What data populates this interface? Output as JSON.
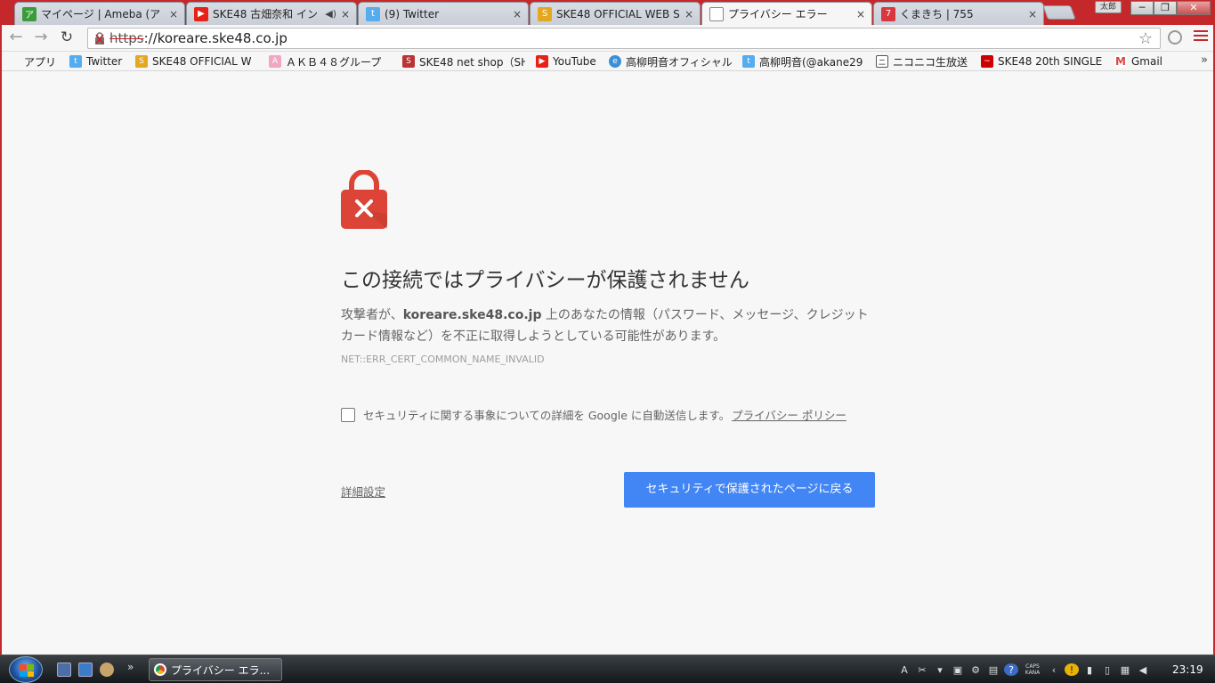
{
  "tabs": [
    {
      "title": "マイページ | Ameba (ア",
      "favicon": "ameba-icon",
      "active": false
    },
    {
      "title": "SKE48 古畑奈和 イン",
      "favicon": "youtube-icon",
      "active": false,
      "muted": true
    },
    {
      "title": "(9) Twitter",
      "favicon": "twitter-icon",
      "active": false
    },
    {
      "title": "SKE48 OFFICIAL WEB S",
      "favicon": "ske48-icon",
      "active": false
    },
    {
      "title": "プライバシー エラー",
      "favicon": "page-icon",
      "active": true
    },
    {
      "title": "くまきち | 755",
      "favicon": "755-icon",
      "active": false
    }
  ],
  "tab_close": "×",
  "mute_glyph": "◀)",
  "profile_badge": "太郎",
  "window_controls": {
    "minimize": "─",
    "restore": "❐",
    "close": "✕"
  },
  "toolbar": {
    "back": "←",
    "forward": "→",
    "reload": "↻",
    "url_scheme": "https",
    "url_rest": "://koreare.ske48.co.jp",
    "star": "☆"
  },
  "bookmarks": [
    {
      "label": "アプリ",
      "icon": "apps-icon"
    },
    {
      "label": "Twitter",
      "icon": "twitter-icon"
    },
    {
      "label": "SKE48 OFFICIAL W",
      "icon": "ske48-icon"
    },
    {
      "label": "ＡＫＢ４８グループ",
      "icon": "akb48-icon"
    },
    {
      "label": "SKE48 net shop（SH",
      "icon": "netshop-icon"
    },
    {
      "label": "YouTube",
      "icon": "youtube-icon"
    },
    {
      "label": "高柳明音オフィシャル",
      "icon": "blog-icon"
    },
    {
      "label": "高柳明音(@akane29",
      "icon": "twitter-icon"
    },
    {
      "label": "ニコニコ生放送",
      "icon": "niconico-icon"
    },
    {
      "label": "SKE48 20th SINGLE",
      "icon": "ske-single-icon"
    },
    {
      "label": "Gmail",
      "icon": "gmail-icon"
    }
  ],
  "bookmarks_more": "»",
  "interstitial": {
    "heading": "この接続ではプライバシーが保護されません",
    "explain_before": "攻撃者が、",
    "explain_host": "koreare.ske48.co.jp",
    "explain_after": " 上のあなたの情報（パスワード、メッセージ、クレジット カード情報など）を不正に取得しようとしている可能性があります。",
    "error_code": "NET::ERR_CERT_COMMON_NAME_INVALID",
    "optin_text": "セキュリティに関する事象についての詳細を Google に自動送信します。",
    "optin_link": "プライバシー ポリシー",
    "details_link": "詳細設定",
    "back_button": "セキュリティで保護されたページに戻る",
    "accent_color": "#4285f4",
    "lock_color": "#db4437"
  },
  "taskbar": {
    "item_label": "プライバシー エラ...",
    "quicklaunch_more": "»",
    "caps_label": "CAPS",
    "kana_label": "KANA",
    "clock": "23:19"
  }
}
